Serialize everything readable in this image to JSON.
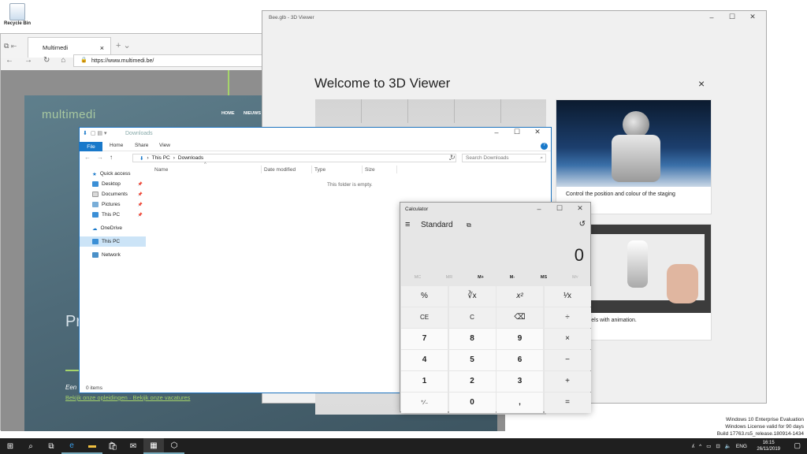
{
  "desktop": {
    "recycle_bin_label": "Recycle Bin"
  },
  "edge": {
    "tab_title": "Multimedi",
    "url": "https://www.multimedi.be/",
    "site": {
      "logo": "multimedi",
      "nav": [
        "HOME",
        "NIEUWS"
      ],
      "hero_partial": "Pr",
      "cta_text": "Een",
      "cta_links": "Bekijk onze opleidingen · Bekijk onze vacatures"
    }
  },
  "viewer": {
    "title": "Bee.glb - 3D Viewer",
    "welcome": "Welcome to 3D Viewer",
    "close": "×",
    "card1_text": "Control the position and colour of the staging",
    "card2_text": "to 3D models with animation."
  },
  "explorer": {
    "title": "Downloads",
    "ribbon": {
      "file": "File",
      "home": "Home",
      "share": "Share",
      "view": "View"
    },
    "address": [
      "This PC",
      "Downloads"
    ],
    "search_placeholder": "Search Downloads",
    "columns": [
      "Name",
      "Date modified",
      "Type",
      "Size"
    ],
    "empty_message": "This folder is empty.",
    "status": "0 items",
    "nav": [
      {
        "label": "Quick access",
        "icon": "star-icon"
      },
      {
        "label": "Desktop",
        "icon": "desktop-folder-icon"
      },
      {
        "label": "Documents",
        "icon": "documents-folder-icon"
      },
      {
        "label": "Pictures",
        "icon": "pictures-folder-icon"
      },
      {
        "label": "This PC",
        "icon": "pc-icon"
      },
      {
        "label": "OneDrive",
        "icon": "cloud-icon"
      },
      {
        "label": "This PC",
        "icon": "pc-icon"
      },
      {
        "label": "Network",
        "icon": "network-icon"
      }
    ]
  },
  "calculator": {
    "title": "Calculator",
    "mode": "Standard",
    "display": "0",
    "memory": [
      "MC",
      "MR",
      "M+",
      "M-",
      "MS",
      "M˅"
    ],
    "keys": [
      [
        "%",
        "∛x",
        "x²",
        "¹⁄x"
      ],
      [
        "CE",
        "C",
        "⌫",
        "÷"
      ],
      [
        "7",
        "8",
        "9",
        "×"
      ],
      [
        "4",
        "5",
        "6",
        "−"
      ],
      [
        "1",
        "2",
        "3",
        "+"
      ],
      [
        "⁺∕₋",
        "0",
        ",",
        "="
      ]
    ]
  },
  "taskbar": {
    "language": "ENG",
    "time": "16:15",
    "date": "26/11/2019"
  },
  "watermark": {
    "line1": "Windows 10 Enterprise Evaluation",
    "line2": "Windows License valid for 90 days",
    "line3": "Build 17763.rs5_release.180914-1434"
  }
}
